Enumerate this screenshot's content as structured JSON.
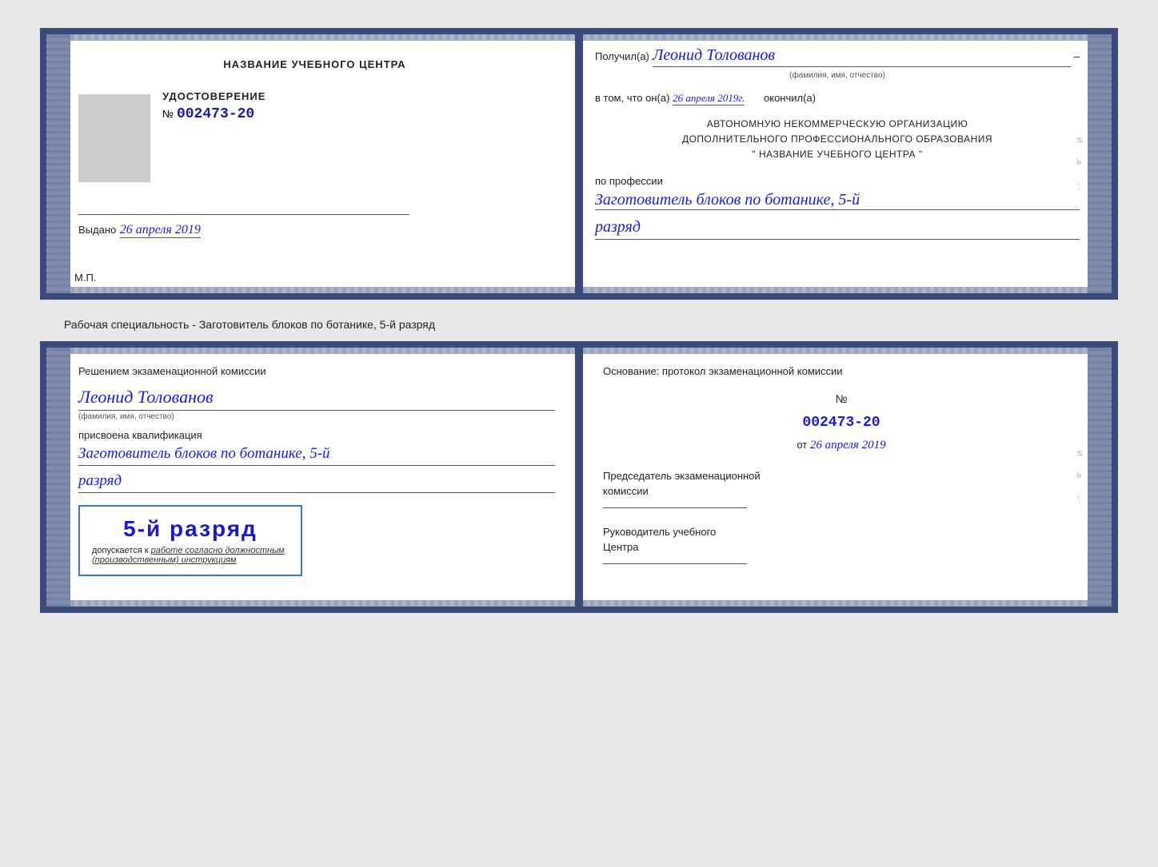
{
  "document1": {
    "left": {
      "title": "НАЗВАНИЕ УЧЕБНОГО ЦЕНТРА",
      "photoAlt": "photo placeholder",
      "udostoverenie": "УДОСТОВЕРЕНИЕ",
      "number_prefix": "№",
      "number": "002473-20",
      "vydano_label": "Выдано",
      "vydano_date": "26 апреля 2019",
      "mp": "М.П."
    },
    "right": {
      "poluchil_label": "Получил(а)",
      "poluchil_name": "Леонид Толованов",
      "fio_caption": "(фамилия, имя, отчество)",
      "dash": "–",
      "vtom_label": "в том, что он(а)",
      "vtom_date": "26 апреля 2019г.",
      "okончил_label": "окончил(а)",
      "org_line1": "АВТОНОМНУЮ НЕКОММЕРЧЕСКУЮ ОРГАНИЗАЦИЮ",
      "org_line2": "ДОПОЛНИТЕЛЬНОГО ПРОФЕССИОНАЛЬНОГО ОБРАЗОВАНИЯ",
      "org_line3": "\"  НАЗВАНИЕ УЧЕБНОГО ЦЕНТРА  \"",
      "po_professii_label": "по профессии",
      "profession": "Заготовитель блоков по ботанике, 5-й",
      "razryad": "разряд"
    }
  },
  "specialty_text": "Рабочая специальность - Заготовитель блоков по ботанике, 5-й разряд",
  "document2": {
    "left": {
      "resheniem_line1": "Решением экзаменационной комиссии",
      "person_name": "Леонид Толованов",
      "fio_caption": "(фамилия, имя, отчество)",
      "prisvoena": "присвоена квалификация",
      "qualification": "Заготовитель блоков по ботанике, 5-й",
      "razryad": "разряд",
      "stamp_razryad": "5-й разряд",
      "dopuskaetsya_label": "допускается к",
      "dopuskaetsya_value": "работе согласно должностным",
      "dopuskaetsya_value2": "(производственным) инструкциям"
    },
    "right": {
      "osnovanie_label": "Основание: протокол экзаменационной комиссии",
      "proto_prefix": "№",
      "proto_number": "002473-20",
      "ot_label": "от",
      "ot_date": "26 апреля 2019",
      "predsedatel_line1": "Председатель экзаменационной",
      "predsedatel_line2": "комиссии",
      "rukovoditel_line1": "Руководитель учебного",
      "rukovoditel_line2": "Центра"
    }
  },
  "icons": {
    "spine": "spine"
  }
}
